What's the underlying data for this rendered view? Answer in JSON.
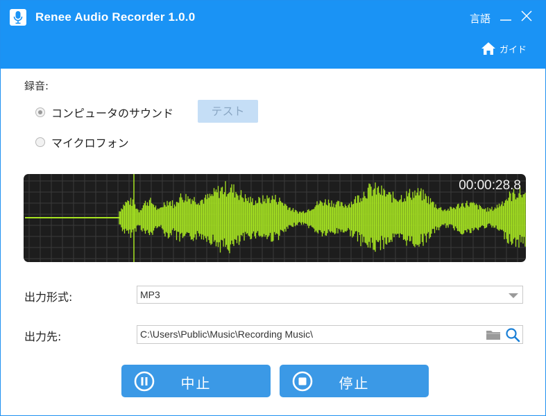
{
  "titlebar": {
    "app_title": "Renee Audio Recorder 1.0.0",
    "language_label": "言語",
    "guide_label": "ガイド"
  },
  "recording": {
    "section_label": "録音:",
    "options": [
      {
        "label": "コンピュータのサウンド",
        "selected": true
      },
      {
        "label": "マイクロフォン",
        "selected": false
      }
    ],
    "test_label": "テスト"
  },
  "waveform": {
    "timer": "00:00:28.8",
    "wave_color": "#a7e521",
    "background": "#1d1d1d"
  },
  "output": {
    "format_label": "出力形式:",
    "format_value": "MP3",
    "dest_label": "出力先:",
    "dest_value": "C:\\Users\\Public\\Music\\Recording Music\\"
  },
  "actions": {
    "pause_label": "中止",
    "stop_label": "停止"
  },
  "colors": {
    "accent": "#1a93f5",
    "button": "#3b99e6"
  }
}
